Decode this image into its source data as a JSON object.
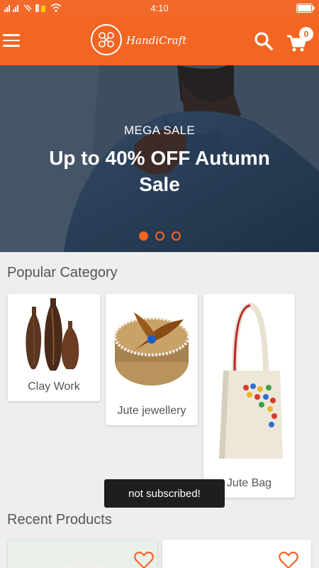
{
  "status_bar": {
    "time": "4:10"
  },
  "app_bar": {
    "logo_text": "HandiCraft",
    "cart_count": "0",
    "menu_icon": "hamburger-menu-icon",
    "search_icon": "search-icon",
    "cart_icon": "cart-icon"
  },
  "banner": {
    "subtitle": "MEGA SALE",
    "title": "Up to 40% OFF Autumn Sale",
    "slides_total": 3,
    "active_slide": 1
  },
  "popular_category": {
    "title": "Popular Category",
    "items": [
      {
        "label": "Clay Work"
      },
      {
        "label": "Jute jewellery"
      },
      {
        "label": "Jute Bag"
      }
    ]
  },
  "toast": {
    "message": "not subscribed!"
  },
  "recent_products": {
    "title": "Recent Products"
  },
  "colors": {
    "accent": "#f26523",
    "background": "#eeeeee",
    "text": "#555555"
  }
}
